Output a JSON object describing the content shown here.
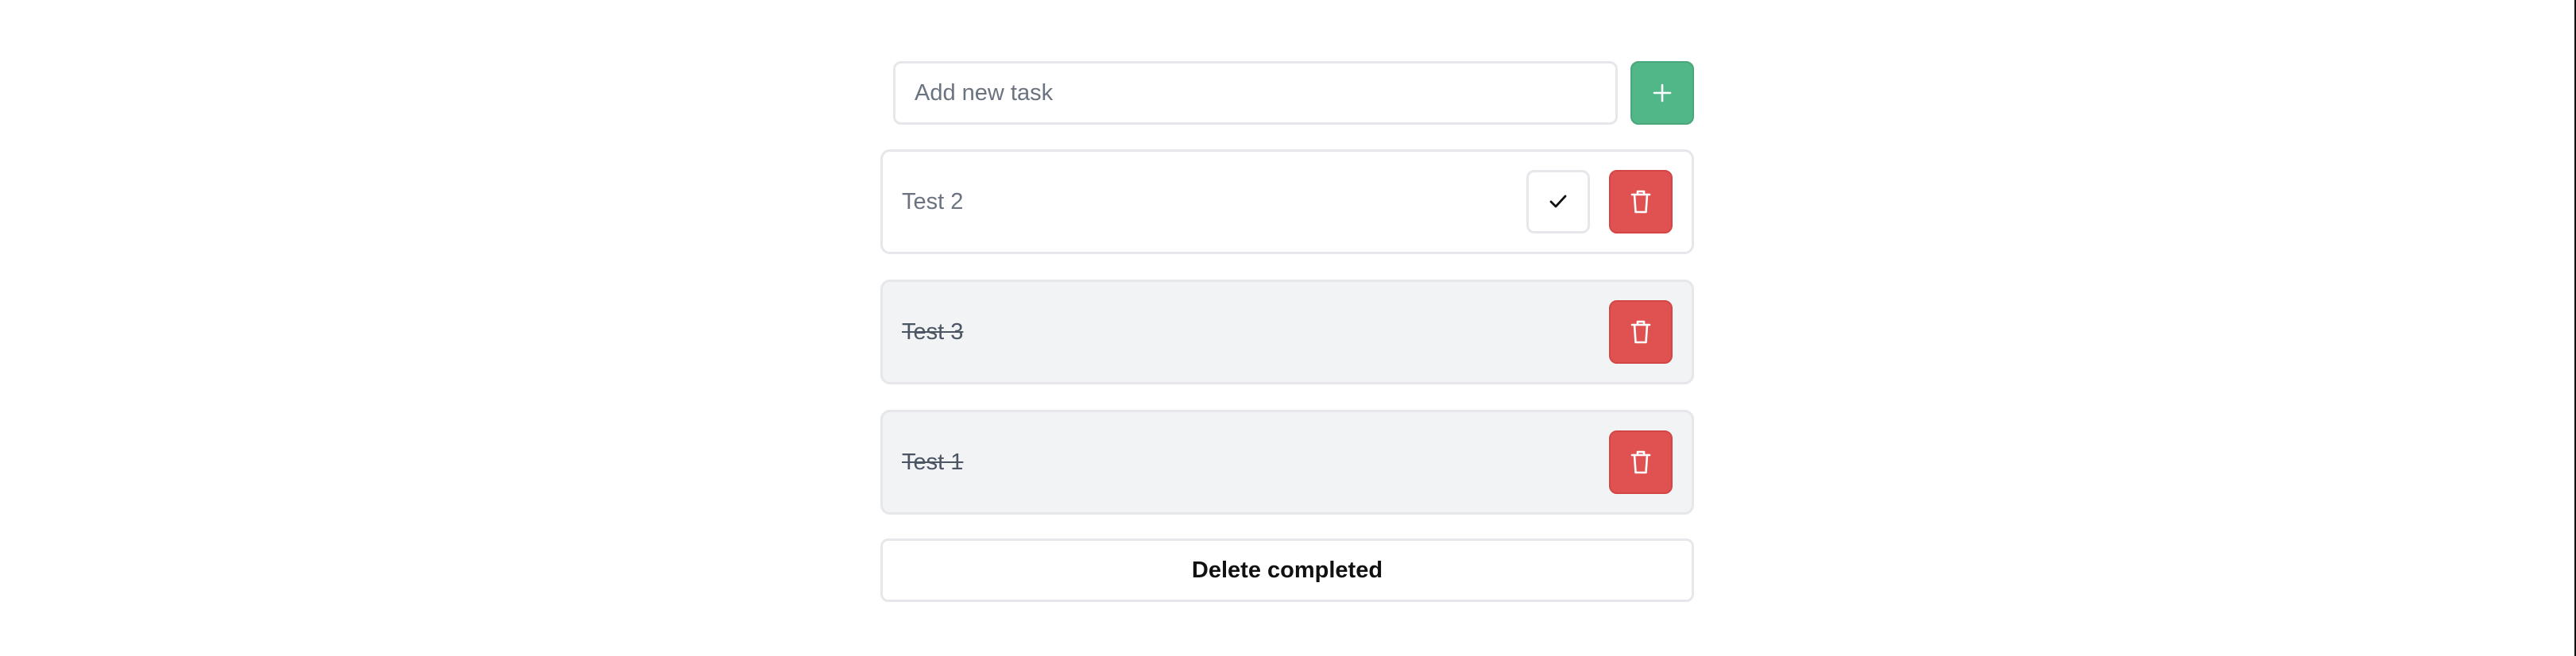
{
  "add_task": {
    "placeholder": "Add new task",
    "value": "",
    "add_button_icon": "plus-icon"
  },
  "tasks": [
    {
      "text": "Test 2",
      "completed": false,
      "complete_icon": "check-icon",
      "delete_icon": "trash-icon"
    },
    {
      "text": "Test 3",
      "completed": true,
      "delete_icon": "trash-icon"
    },
    {
      "text": "Test 1",
      "completed": true,
      "delete_icon": "trash-icon"
    }
  ],
  "footer": {
    "delete_completed_label": "Delete completed"
  },
  "colors": {
    "add_button": "#52b788",
    "delete_button": "#e05252",
    "completed_task_bg": "#f2f3f5",
    "border": "#e5e7eb"
  }
}
